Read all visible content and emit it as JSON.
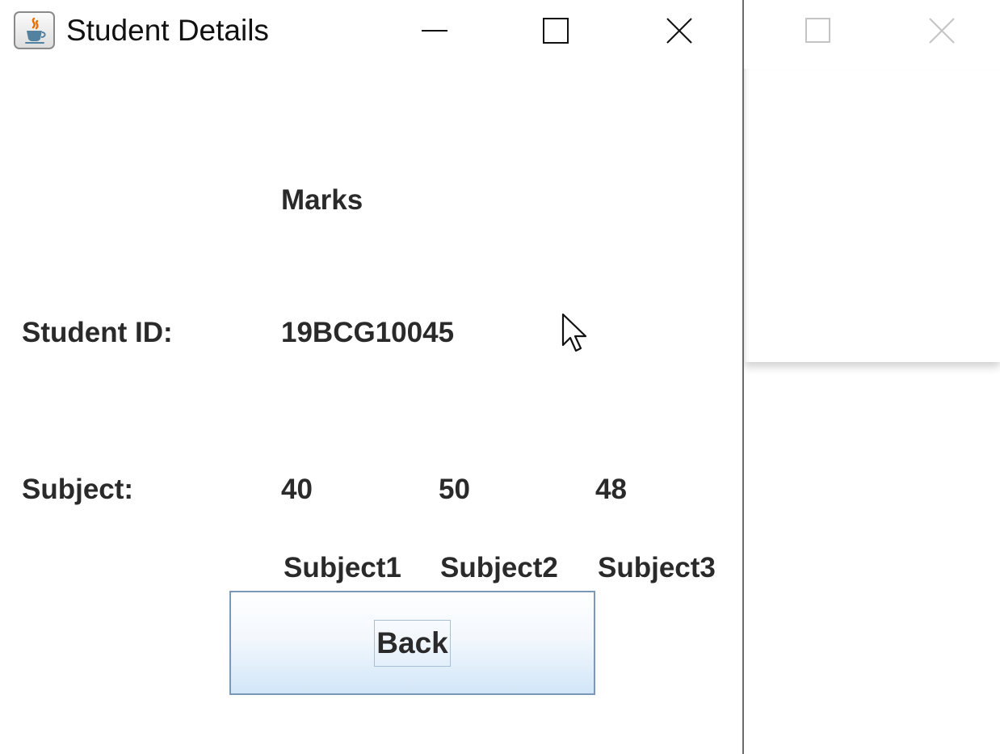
{
  "window": {
    "title": "Student Details",
    "app_icon": "java-cup-icon",
    "controls": {
      "minimize": "minimize-icon",
      "maximize": "maximize-icon",
      "close": "close-icon"
    }
  },
  "background_window": {
    "controls": {
      "maximize": "maximize-icon",
      "close": "close-icon"
    }
  },
  "content": {
    "marks_heading": "Marks",
    "student_id_label": "Student ID:",
    "student_id_value": "19BCG10045",
    "subject_label": "Subject:",
    "marks": [
      "40",
      "50",
      "48"
    ],
    "subjects": [
      "Subject1",
      "Subject2",
      "Subject3"
    ]
  },
  "buttons": {
    "back_label": "Back"
  },
  "colors": {
    "button_gradient_top": "#ffffff",
    "button_gradient_bottom": "#d2e6f8",
    "button_border": "#7a98b8",
    "label_text": "#2a2a2a"
  }
}
